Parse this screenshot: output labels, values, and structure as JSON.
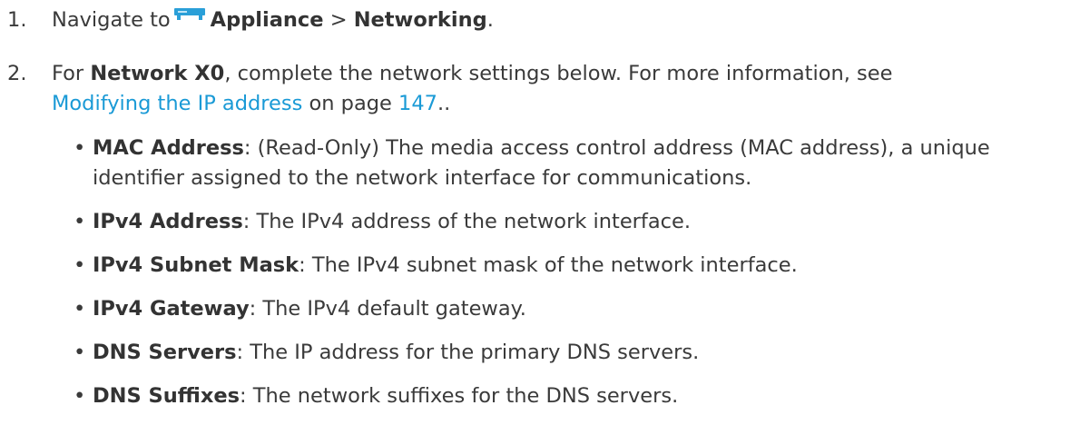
{
  "steps": [
    {
      "number": "1.",
      "prefix": "Navigate to",
      "icon": "appliance-icon",
      "location": "Appliance",
      "separator": ">",
      "section": "Networking",
      "suffix": "."
    },
    {
      "number": "2.",
      "prefix": "For",
      "subject": "Network X0",
      "text": ", complete the network settings below. For more information, see",
      "link_text": "Modifying the IP address",
      "page_prefix": "on page",
      "page_link": "147",
      "suffix": ".."
    }
  ],
  "fields": [
    {
      "label": "MAC Address",
      "description": ": (Read-Only) The media access control address (MAC address), a unique identifier assigned to the network interface for communications."
    },
    {
      "label": "IPv4 Address",
      "description": ": The IPv4 address of the network interface."
    },
    {
      "label": "IPv4 Subnet Mask",
      "description": ": The IPv4 subnet mask of the network interface."
    },
    {
      "label": "IPv4 Gateway",
      "description": ": The IPv4 default gateway."
    },
    {
      "label": "DNS Servers",
      "description": ": The IP address for the primary DNS servers."
    },
    {
      "label": "DNS Suffixes",
      "description": ": The network suffixes for the DNS servers."
    }
  ],
  "bullet_char": "•",
  "colors": {
    "text": "#3a3a3a",
    "link": "#1a9ad6",
    "icon": "#2a9fd8"
  }
}
